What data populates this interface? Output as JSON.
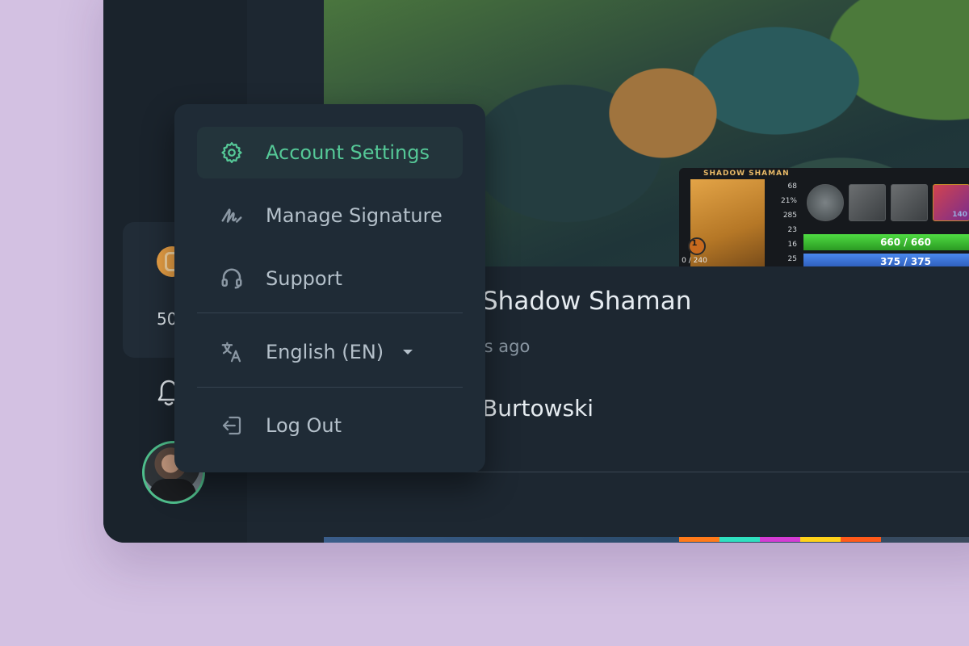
{
  "sidebar": {
    "credit_value": "50",
    "avatar_name": "avatar"
  },
  "video": {
    "hud": {
      "hero_title": "SHADOW SHAMAN",
      "stats": [
        "68",
        "21%",
        "285",
        "23",
        "16",
        "25"
      ],
      "level": "1",
      "xp": "0 / 240",
      "ult_level": "140",
      "hp": "660 / 660",
      "mana": "375 / 375"
    },
    "title": "s Shadow Shaman",
    "time": "rs ago",
    "author": "Burtowski"
  },
  "menu": {
    "items": [
      {
        "label": "Account Settings",
        "icon": "gear-icon",
        "active": true
      },
      {
        "label": "Manage Signature",
        "icon": "signature-icon"
      },
      {
        "label": "Support",
        "icon": "headset-icon"
      }
    ],
    "language": {
      "label": "English (EN)",
      "icon": "translate-icon"
    },
    "logout": {
      "label": "Log Out",
      "icon": "logout-icon"
    }
  },
  "colors": {
    "accent": "#55c897",
    "background": "#d3c1e2",
    "panel": "#1f2b36"
  }
}
